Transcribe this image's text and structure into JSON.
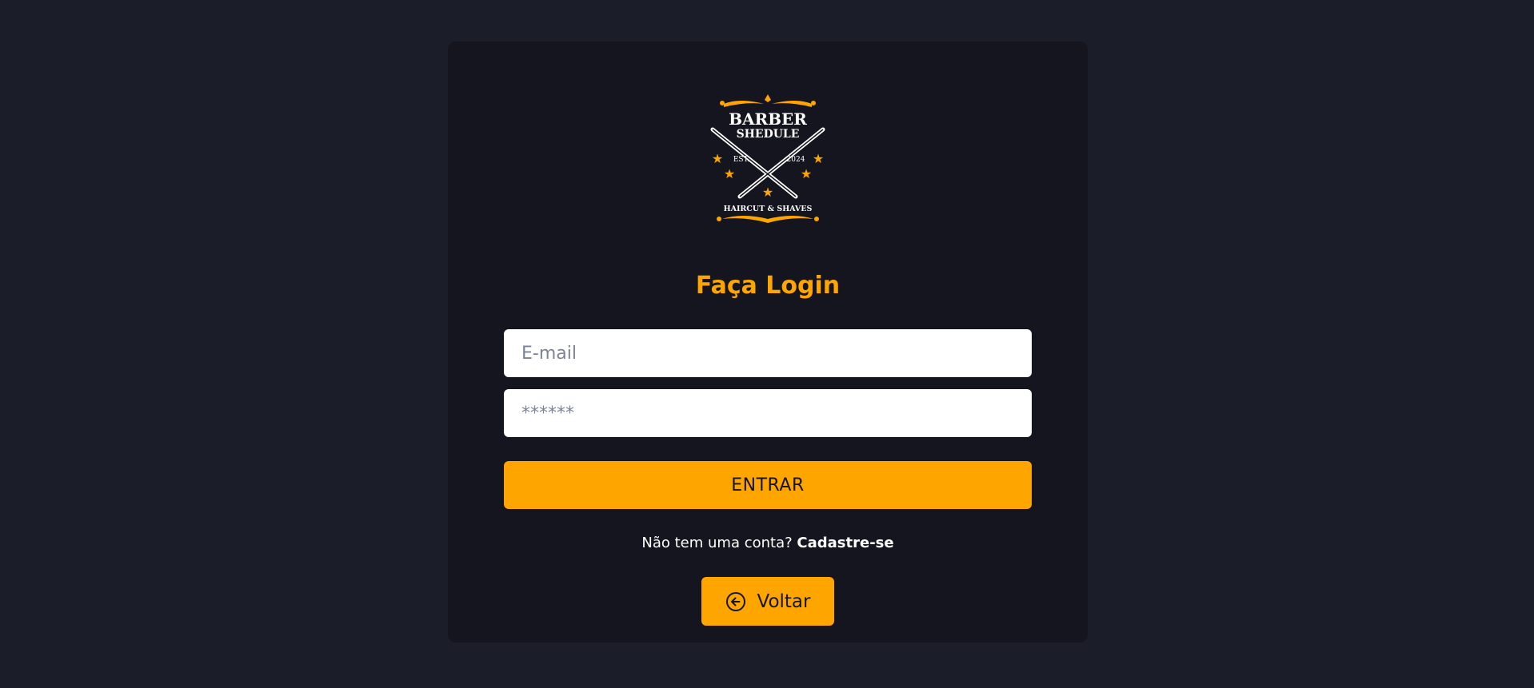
{
  "logo": {
    "line1": "BARBER",
    "line2": "SHEDULE",
    "est_left": "EST.",
    "est_right": "2024",
    "tagline": "HAIRCUT & SHAVES",
    "icon": "crossed-razors-logo"
  },
  "title": "Faça Login",
  "email": {
    "placeholder": "E-mail",
    "value": ""
  },
  "password": {
    "placeholder": "******",
    "value": ""
  },
  "submit_label": "ENTRAR",
  "signup": {
    "prompt": "Não tem uma conta?",
    "link": "Cadastre-se"
  },
  "back": {
    "label": "Voltar",
    "icon": "arrow-left-circle-icon"
  },
  "colors": {
    "background": "#1b1d29",
    "card": "#14151e",
    "accent": "#ffa500",
    "input": "#ffffff"
  }
}
